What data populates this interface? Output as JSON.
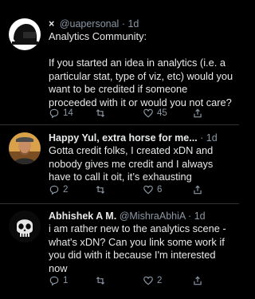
{
  "tweets": [
    {
      "prefix": "×",
      "display_name": "",
      "handle": "@uapersonal",
      "separator": "·",
      "time": "1d",
      "text": "Analytics Community:\n\nIf you started an idea in analytics (i.e. a particular stat, type of viz, etc) would you want to be credited if someone proceeded with it or would you not care?",
      "replies": "14",
      "retweets": "",
      "likes": "45",
      "avatar_icon": "helmet-avatar-icon"
    },
    {
      "prefix": "",
      "display_name": "Happy Yul, extra horse for me...",
      "handle": "",
      "separator": "·",
      "time": "1d",
      "text": "Gotta credit folks, I created xDN and nobody gives me credit and I always have to call it oit, it’s exhausting",
      "replies": "2",
      "retweets": "",
      "likes": "6",
      "avatar_icon": "person-avatar-icon"
    },
    {
      "prefix": "",
      "display_name": "Abhishek A M.",
      "handle": "@MishraAbhiA",
      "separator": "·",
      "time": "1d",
      "text": "i am rather new to the analytics scene - what's xDN? Can you link some work if you did with it because I'm interested now",
      "replies": "1",
      "retweets": "",
      "likes": "2",
      "avatar_icon": "skull-avatar-icon"
    }
  ],
  "colors": {
    "background": "#000000",
    "text": "#e7e9ea",
    "muted": "#8b98a5",
    "divider": "#2f3336"
  },
  "icons": [
    "reply-icon",
    "retweet-icon",
    "like-icon",
    "share-icon"
  ]
}
